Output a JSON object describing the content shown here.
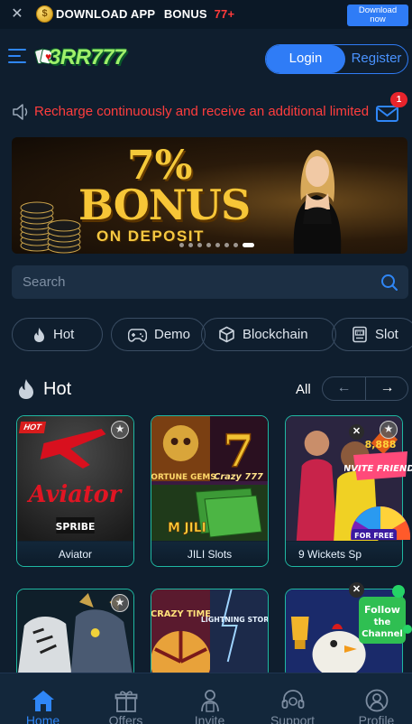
{
  "download_bar": {
    "text": "DOWNLOAD APP",
    "bonus_label": "BONUS",
    "bonus_value": "77+",
    "button_line1": "Download",
    "button_line2": "now",
    "accent": "#2f7cf6"
  },
  "header": {
    "logo_text": "3RR777",
    "login_label": "Login",
    "register_label": "Register"
  },
  "announcement": {
    "text": "Recharge continuously and receive an additional limited",
    "mail_badge_count": "1",
    "text_color": "#ff3d3d"
  },
  "banner": {
    "headline_percent": "7%",
    "headline_word": "BONUS",
    "subtitle": "ON DEPOSIT",
    "slide_count": 8,
    "active_slide": 7
  },
  "search": {
    "placeholder": "Search",
    "value": ""
  },
  "categories": [
    {
      "label": "Hot",
      "icon": "flame-icon"
    },
    {
      "label": "Demo",
      "icon": "gamepad-icon"
    },
    {
      "label": "Blockchain",
      "icon": "cube-icon"
    },
    {
      "label": "Slot",
      "icon": "slot-machine-icon"
    }
  ],
  "hot_section": {
    "title": "Hot",
    "all_label": "All",
    "prev_arrow": "←",
    "next_arrow": "→"
  },
  "games": [
    {
      "name": "Aviator",
      "art_text": "Aviator",
      "provider": "SPRIBE",
      "badge": "HOT"
    },
    {
      "name": "JILI Slots",
      "art_top": "FORTUNE GEMS",
      "art_mid": "Crazy 777",
      "art_bottom": "M JILI"
    },
    {
      "name": "9 Wickets Sp",
      "art_text": ""
    },
    {
      "name": "",
      "art_text": ""
    },
    {
      "name": "",
      "art_top": "CRAZY TIME",
      "art_mid": "LIGHTNING STORM"
    },
    {
      "name": "",
      "art_text": ""
    }
  ],
  "promos": {
    "invite_lines": [
      "INVITE FRIENDS"
    ],
    "invite_amount": "8,888",
    "invite_wheel": "FOR FREE",
    "follow_lines": [
      "Follow",
      "the",
      "Channel"
    ]
  },
  "bottom_nav": [
    {
      "label": "Home",
      "icon": "home-icon",
      "active": true
    },
    {
      "label": "Offers",
      "icon": "gift-icon",
      "active": false
    },
    {
      "label": "Invite",
      "icon": "invite-icon",
      "active": false
    },
    {
      "label": "Support",
      "icon": "headset-icon",
      "active": false
    },
    {
      "label": "Profile",
      "icon": "profile-icon",
      "active": false
    }
  ]
}
